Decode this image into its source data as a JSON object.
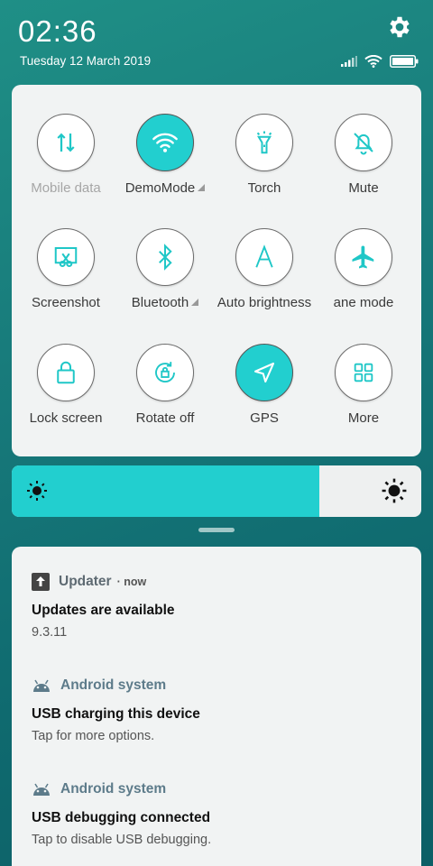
{
  "status": {
    "time": "02:36",
    "date": "Tuesday 12 March 2019"
  },
  "quick_settings": {
    "tiles": [
      {
        "label": "Mobile data",
        "icon": "mobile-data-icon",
        "active": false,
        "dim": true
      },
      {
        "label": "DemoMode",
        "icon": "wifi-icon",
        "active": true,
        "expand": true
      },
      {
        "label": "Torch",
        "icon": "torch-icon",
        "active": false
      },
      {
        "label": "Mute",
        "icon": "mute-bell-icon",
        "active": false
      },
      {
        "label": "Screenshot",
        "icon": "screenshot-icon",
        "active": false
      },
      {
        "label": "Bluetooth",
        "icon": "bluetooth-icon",
        "active": false,
        "expand": true
      },
      {
        "label": "Auto brightness",
        "icon": "auto-brightness-icon",
        "active": false
      },
      {
        "label": "ane mode",
        "icon": "airplane-icon",
        "active": false
      },
      {
        "label": "Lock screen",
        "icon": "lock-icon",
        "active": false
      },
      {
        "label": "Rotate off",
        "icon": "rotate-lock-icon",
        "active": false
      },
      {
        "label": "GPS",
        "icon": "gps-icon",
        "active": true
      },
      {
        "label": "More",
        "icon": "grid-icon",
        "active": false
      }
    ]
  },
  "brightness": {
    "level": 0.75
  },
  "notifications": [
    {
      "app": "Updater",
      "when": "now",
      "title": "Updates are available",
      "body": "9.3.11",
      "icon": "update-arrow-icon"
    },
    {
      "app": "Android system",
      "title": "USB charging this device",
      "body": "Tap for more options.",
      "icon": "android-icon"
    },
    {
      "app": "Android system",
      "title": "USB debugging connected",
      "body": "Tap to disable USB debugging.",
      "icon": "android-icon"
    }
  ],
  "colors": {
    "accent": "#22cfcf",
    "panel": "#f1f3f3"
  }
}
